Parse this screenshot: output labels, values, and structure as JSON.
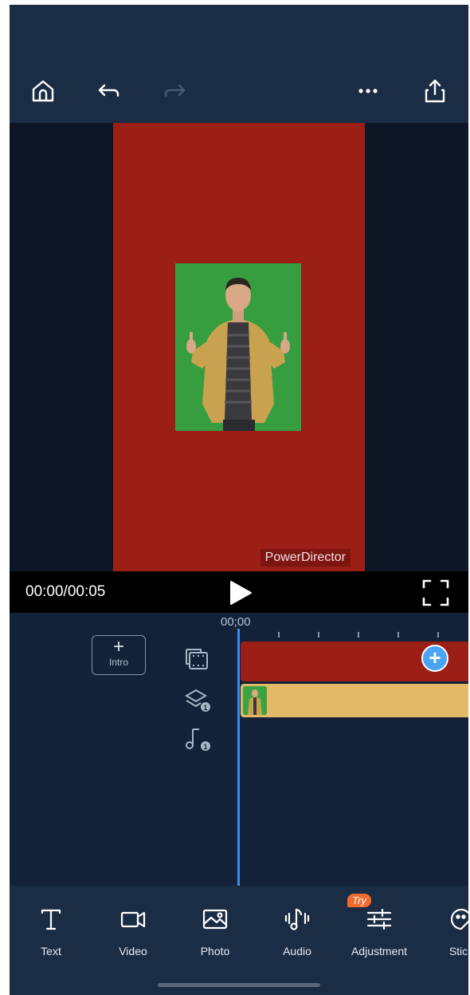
{
  "preview": {
    "watermark": "PowerDirector"
  },
  "playback": {
    "timecode": "00:00/00:05"
  },
  "timeline": {
    "intro_plus": "+",
    "intro_label": "Intro",
    "ruler_start": "00;00",
    "overlay_badge": "1",
    "audio_badge": "1"
  },
  "toolbar": {
    "try_badge": "Try",
    "items": [
      {
        "label": "Text",
        "icon": "text-icon"
      },
      {
        "label": "Video",
        "icon": "video-camera-icon"
      },
      {
        "label": "Photo",
        "icon": "photo-icon"
      },
      {
        "label": "Audio",
        "icon": "audio-note-icon"
      },
      {
        "label": "Adjustment",
        "icon": "sliders-icon"
      },
      {
        "label": "Stick",
        "icon": "sticker-icon"
      }
    ]
  },
  "colors": {
    "background": "#132238",
    "canvas_red": "#9b1e17",
    "overlay_clip": "#e3b867",
    "accent_blue": "#3d8cf0",
    "try_orange": "#f26b2e"
  }
}
